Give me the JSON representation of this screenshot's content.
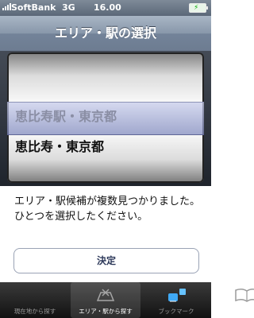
{
  "status_bar": {
    "carrier": "SoftBank",
    "network": "3G",
    "time": "16.00",
    "battery_icon": "battery-charging-icon"
  },
  "nav": {
    "title": "エリア・駅の選択"
  },
  "picker": {
    "items": [
      "恵比寿駅・東京都",
      "恵比寿・東京都"
    ],
    "selected_index": 1
  },
  "message": "エリア・駅候補が複数見つかりました。ひとつを選択したください。",
  "confirm_button": "決定",
  "tabbar": {
    "tabs": [
      {
        "label": "現在地から探す",
        "icon": "location-icon",
        "active": false
      },
      {
        "label": "エリア・駅から探す",
        "icon": "station-icon",
        "active": true
      },
      {
        "label": "ブックマーク",
        "icon": "bookmark-book-icon",
        "active": false
      }
    ]
  }
}
